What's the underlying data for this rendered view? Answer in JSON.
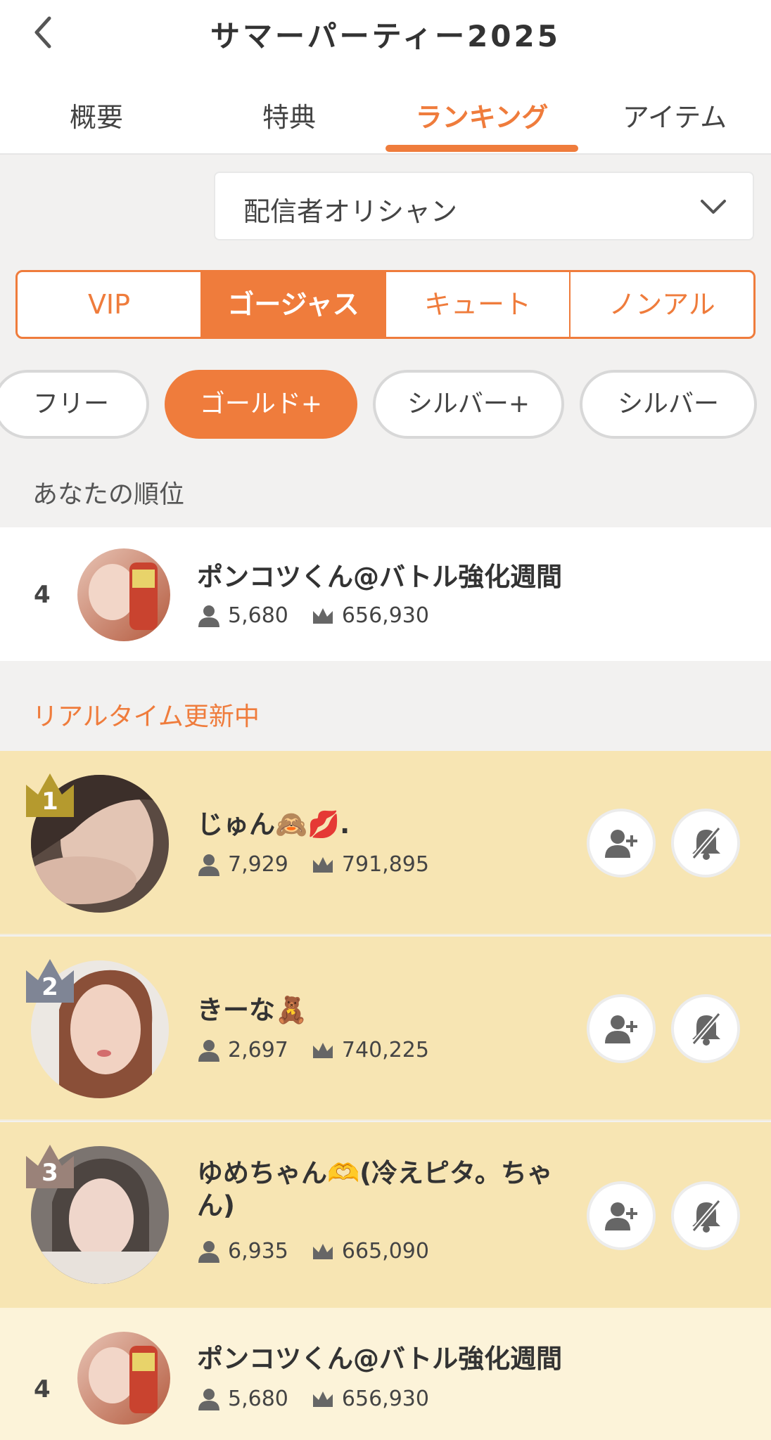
{
  "header": {
    "title": "サマーパーティー2025"
  },
  "tabs": [
    {
      "label": "概要"
    },
    {
      "label": "特典"
    },
    {
      "label": "ランキング"
    },
    {
      "label": "アイテム"
    }
  ],
  "selector": {
    "value": "配信者オリシャン"
  },
  "segments": [
    {
      "label": "VIP"
    },
    {
      "label": "ゴージャス"
    },
    {
      "label": "キュート"
    },
    {
      "label": "ノンアル"
    }
  ],
  "pills": [
    {
      "label": "フリー"
    },
    {
      "label": "ゴールド+"
    },
    {
      "label": "シルバー+"
    },
    {
      "label": "シルバー"
    }
  ],
  "my_rank": {
    "section_label": "あなたの順位",
    "rank": "4",
    "name": "ポンコツくん@バトル強化週間",
    "followers": "5,680",
    "points": "656,930"
  },
  "realtime_label": "リアルタイム更新中",
  "ranking": [
    {
      "rank": "1",
      "name": "じゅん🙈💋.",
      "followers": "7,929",
      "points": "791,895"
    },
    {
      "rank": "2",
      "name": "きーな🧸",
      "followers": "2,697",
      "points": "740,225"
    },
    {
      "rank": "3",
      "name": "ゆめちゃん🫶(冷えピタ。ちゃん)",
      "followers": "6,935",
      "points": "665,090"
    },
    {
      "rank": "4",
      "name": "ポンコツくん@バトル強化週間",
      "followers": "5,680",
      "points": "656,930"
    }
  ],
  "colors": {
    "accent": "#ef7c3c",
    "gold_row": "#f7e5b3",
    "pale_row": "#fcf3d9",
    "crown_gold": "#b59a2e",
    "crown_silver": "#7f8595",
    "crown_bronze": "#9a8279"
  }
}
